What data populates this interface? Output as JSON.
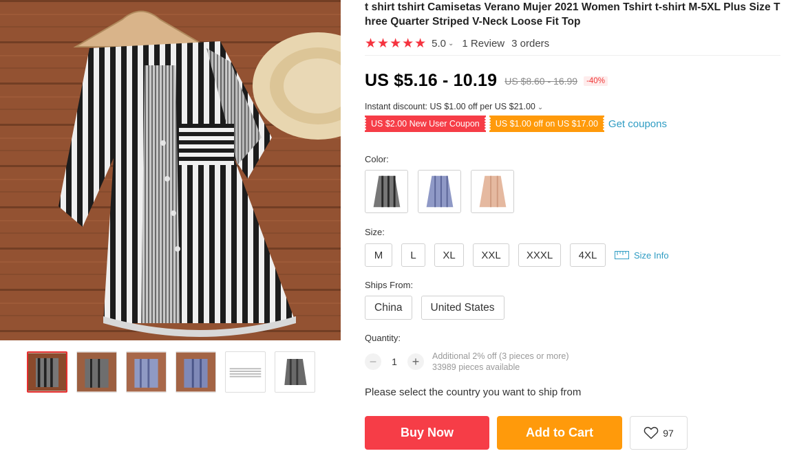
{
  "product": {
    "title": "t shirt tshirt Camisetas Verano Mujer 2021 Women Tshirt t-shirt M-5XL Plus Size Three Quarter Striped V-Neck Loose Fit Top",
    "rating": {
      "stars": "★★★★★",
      "value": "5.0",
      "reviews": "1 Review",
      "orders": "3 orders"
    },
    "price": {
      "current": "US $5.16 - 10.19",
      "original": "US $8.60 - 16.99",
      "discount": "-40%"
    },
    "instant_discount": "Instant discount: US $1.00 off per US $21.00",
    "coupons": [
      "US $2.00 New User Coupon",
      "US $1.00 off on US $17.00"
    ],
    "get_coupons": "Get coupons"
  },
  "options": {
    "color_label": "Color:",
    "colors": [
      "gray-striped",
      "blue-striped",
      "pink"
    ],
    "size_label": "Size:",
    "sizes": [
      "M",
      "L",
      "XL",
      "XXL",
      "XXXL",
      "4XL"
    ],
    "size_info": "Size Info",
    "ships_label": "Ships From:",
    "ships_from": [
      "China",
      "United States"
    ],
    "quantity_label": "Quantity:",
    "quantity": "1",
    "qty_minus": "−",
    "qty_plus": "+",
    "qty_note_1": "Additional 2% off (3 pieces or more)",
    "qty_note_2": "33989 pieces available",
    "ship_prompt": "Please select the country you want to ship from"
  },
  "actions": {
    "buy_now": "Buy Now",
    "add_to_cart": "Add to Cart",
    "wishlist_count": "97"
  },
  "colors": {
    "accent_red": "#f63d47",
    "accent_orange": "#ff9a0b",
    "link_blue": "#2e9cc3",
    "star_red": "#f5333f"
  },
  "gallery": {
    "selected_thumbnail": 1
  }
}
